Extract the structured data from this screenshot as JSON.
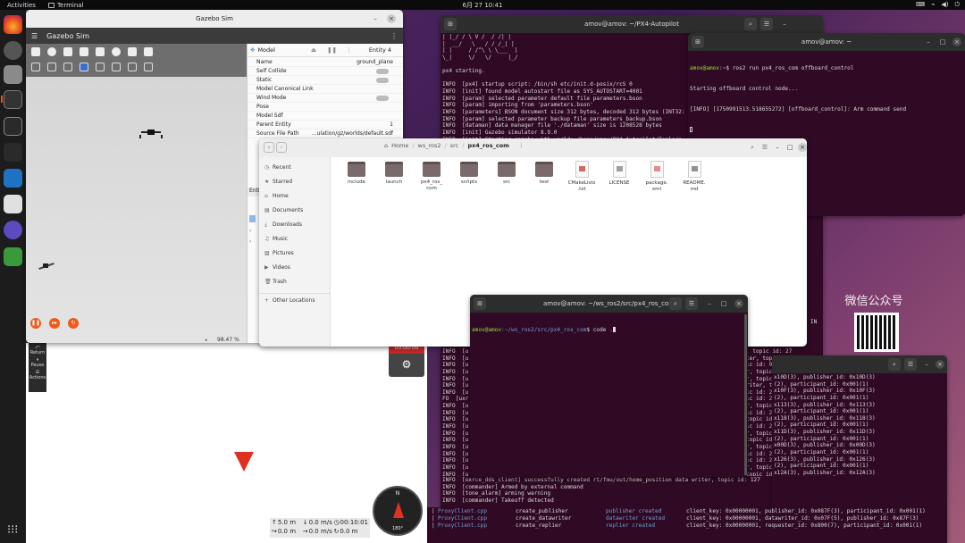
{
  "topbar": {
    "activities": "Activities",
    "app_name": "Terminal",
    "clock": "6月 27  10:41"
  },
  "gazebo": {
    "window_title": "Gazebo Sim",
    "app_title": "Gazebo Sim",
    "panel_title": "Model",
    "entity": "Entity 4",
    "props": [
      {
        "k": "Name",
        "v": "ground_plane"
      },
      {
        "k": "Self Collide",
        "v": ""
      },
      {
        "k": "Static",
        "v": ""
      },
      {
        "k": "Model Canonical Link",
        "v": ""
      },
      {
        "k": "Wind Mode",
        "v": ""
      },
      {
        "k": "Pose",
        "v": ""
      },
      {
        "k": "Model Sdf",
        "v": ""
      },
      {
        "k": "Parent Entity",
        "v": "1"
      },
      {
        "k": "Source File Path",
        "v": "...ulation/gz/worlds/default.sdf"
      }
    ],
    "entity_short": "Enti",
    "zoom": "98.47 %",
    "side_panel": {
      "return_label": "Return",
      "pause_label": "Pause",
      "actions_label": "Actions"
    },
    "rec_time": "00:00:00",
    "telemetry": [
      {
        "icon": "↑",
        "text": "5.0 m"
      },
      {
        "icon": "↓",
        "text": "0.0 m/s"
      },
      {
        "icon": "◷",
        "text": "00:10:01"
      },
      {
        "icon": "↪",
        "text": "0.0 m"
      },
      {
        "icon": "→",
        "text": "0.0 m/s"
      },
      {
        "icon": "↻",
        "text": "0.0 m"
      }
    ],
    "compass": {
      "n": "N",
      "s": "180°"
    }
  },
  "t_autopilot": {
    "title": "amov@amov: ~/PX4-Autopilot",
    "lines": [
      "| |_/ / \\ V /  / /| |",
      "|  __/   \\   / / /_| |",
      "| |     / /^\\ \\ \\___  |",
      "\\_|     \\/   \\/     |_/",
      "",
      "px4 starting.",
      "",
      "INFO  [px4] startup script: /bin/sh etc/init.d-posix/rcS 0",
      "INFO  [init] found model autostart file as SYS_AUTOSTART=4001",
      "INFO  [param] selected parameter default file parameters.bson",
      "INFO  [param] importing from 'parameters.bson'",
      "INFO  [parameters] BSON document size 312 bytes, decoded 312 bytes (INT32:",
      "INFO  [param] selected parameter backup file parameters_backup.bson",
      "INFO  [dataman] data manager file './dataman' size is 1208528 bytes",
      "INFO  [init] Gazebo simulator 8.9.0",
      "INFO  [init] Starting gazebo with world: /home/amov/PX4-Autopilot/Tools/s"
    ],
    "mid_left": [
      "INFO  [u",
      "INFO  [u",
      "INFO  [u",
      "INFO  [u",
      "INFO  [u",
      "INFO  [u",
      "INFO  [u",
      "FO  [uxr",
      "INFO  [u",
      "INFO  [u",
      "INFO  [u",
      "INFO  [u",
      "INFO  [u",
      "INFO  [u",
      "INFO  [u",
      "INFO  [u",
      "INFO  [u",
      "INFO  [u",
      "INFO  [u",
      "INFO  [u"
    ],
    "mid_right": [
      ", topic id: 27",
      "ter, topic id: 84",
      "ic id: 90",
      "r, topic id: 147",
      "r, topic id: 153",
      "riter, topic id: 190IN",
      "ic id: 223",
      "ic id: 246",
      "r, topic id: 274",
      "ic id: 261",
      "topic id: 268",
      "ic id: 271",
      "r, topic id: 269",
      "topic id: 271",
      "r, topic id: 275",
      "ic id: 280",
      "ic id: 285",
      "r, topic id: 13",
      "topic id: 294",
      ""
    ],
    "bottom_lines": [
      "INFO  [uxrce_dds_client] successfully created rt/fmu/out/home_position data writer, topic id: 127",
      "INFO  [commander] Armed by external command",
      "INFO  [tone_alarm] arming warning",
      "INFO  [commander] Takeoff detected"
    ],
    "side_in": "IN"
  },
  "t_offboard": {
    "title": "amov@amov: ~",
    "prompt": "amov@amov",
    "cmd": ":~$ ros2 run px4_ros_com offboard_control",
    "lines": [
      "Starting offboard control node...",
      "[INFO] [1750991513.518655272] [offboard_control]: Arm command send"
    ]
  },
  "files": {
    "path": [
      "Home",
      "ws_ros2",
      "src",
      "px4_ros_com"
    ],
    "sidebar": [
      {
        "icon": "◷",
        "label": "Recent"
      },
      {
        "icon": "★",
        "label": "Starred"
      },
      {
        "icon": "⌂",
        "label": "Home"
      },
      {
        "icon": "▤",
        "label": "Documents"
      },
      {
        "icon": "⤓",
        "label": "Downloads"
      },
      {
        "icon": "♫",
        "label": "Music"
      },
      {
        "icon": "▨",
        "label": "Pictures"
      },
      {
        "icon": "▶",
        "label": "Videos"
      },
      {
        "icon": "🗑",
        "label": "Trash"
      },
      {
        "icon": "+",
        "label": "Other Locations"
      }
    ],
    "items": [
      {
        "name": "include",
        "type": "folder"
      },
      {
        "name": "launch",
        "type": "folder"
      },
      {
        "name": "px4_ros_\ncom",
        "type": "folder"
      },
      {
        "name": "scripts",
        "type": "folder"
      },
      {
        "name": "src",
        "type": "folder"
      },
      {
        "name": "test",
        "type": "folder"
      },
      {
        "name": "CMakeLists\n.txt",
        "type": "cmake"
      },
      {
        "name": "LICENSE",
        "type": "text"
      },
      {
        "name": "package.\nxml",
        "type": "xml"
      },
      {
        "name": "README.\nmd",
        "type": "md"
      }
    ]
  },
  "t_code": {
    "title": "amov@amov: ~/ws_ros2/src/px4_ros_com",
    "prompt_user": "amov@amov",
    "prompt_path": ":~/ws_ros2/src/px4_ros_com",
    "cmd": "$ code ."
  },
  "t_dds": {
    "lines": [
      "x10D(3), publisher_id: 0x10D(3)",
      "(2), participant_id: 0x001(1)",
      "x10F(3), publisher_id: 0x10F(3)",
      "(2), participant_id: 0x001(1)",
      "x113(3), publisher_id: 0x113(3)",
      "(2), participant_id: 0x001(1)",
      "x118(3), publisher_id: 0x118(3)",
      "(2), participant_id: 0x001(1)",
      "x11D(3), publisher_id: 0x11D(3)",
      "(2), participant_id: 0x001(1)",
      "x00D(3), publisher_id: 0x00D(3)",
      "(2), participant_id: 0x001(1)",
      "x126(3), publisher_id: 0x126(3)",
      "(2), participant_id: 0x001(1)",
      "x12A(3), publisher_id: 0x12A(3)"
    ],
    "table": [
      [
        "ProxyClient.cpp",
        "create_publisher",
        "publisher created",
        "client_key: 0x00000001, publisher_id: 0x087F(3), participant_id: 0x001(1)"
      ],
      [
        "ProxyClient.cpp",
        "create_datawriter",
        "datawriter created",
        "client_key: 0x00000001, datawriter_id: 0x07F(5), publisher_id: 0x87F(3)"
      ],
      [
        "ProxyClient.cpp",
        "create_replier",
        "replier created",
        "client_key: 0x00000001, requester_id: 0x800(7), participant_id: 0x001(1)"
      ]
    ]
  },
  "wechat": {
    "label": "微信公众号"
  }
}
